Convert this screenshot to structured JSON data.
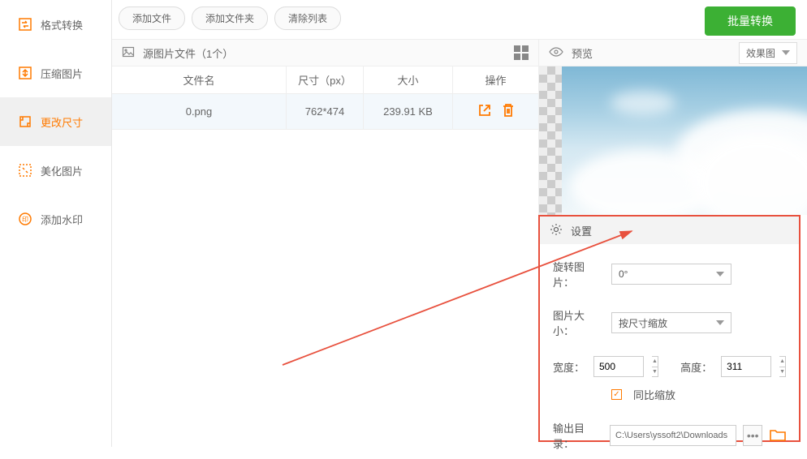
{
  "sidebar": {
    "items": [
      {
        "label": "格式转换"
      },
      {
        "label": "压缩图片"
      },
      {
        "label": "更改尺寸"
      },
      {
        "label": "美化图片"
      },
      {
        "label": "添加水印"
      }
    ]
  },
  "toolbar": {
    "add_file": "添加文件",
    "add_folder": "添加文件夹",
    "clear_list": "清除列表",
    "convert": "批量转换"
  },
  "source": {
    "label": "源图片文件（1个）"
  },
  "table": {
    "headers": {
      "name": "文件名",
      "size_px": "尺寸（px）",
      "filesize": "大小",
      "ops": "操作"
    },
    "rows": [
      {
        "name": "0.png",
        "size_px": "762*474",
        "filesize": "239.91 KB"
      }
    ]
  },
  "preview": {
    "label": "预览",
    "effect": "效果图"
  },
  "settings": {
    "title": "设置",
    "rotate_label": "旋转图片：",
    "rotate_value": "0°",
    "resize_label": "图片大小：",
    "resize_value": "按尺寸缩放",
    "width_label": "宽度：",
    "width_value": "500",
    "height_label": "高度：",
    "height_value": "311",
    "lock_ratio": "同比缩放",
    "output_label": "输出目录：",
    "output_value": "C:\\Users\\yssoft2\\Downloads"
  }
}
